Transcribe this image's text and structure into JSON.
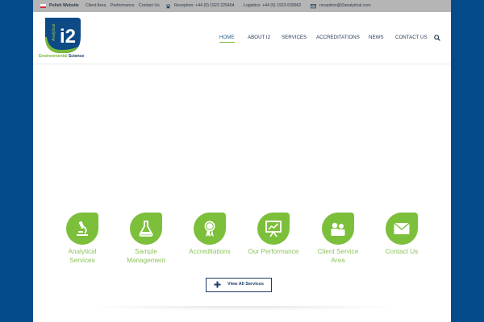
{
  "topbar": {
    "polish_website": "Polish Website",
    "links": [
      "Client Area",
      "Performance",
      "Contact Us"
    ],
    "reception": "Reception: +44 (0) 1923 225404",
    "logistics": "Logistics: +44 (0) 1923 639962",
    "email": "reception@i2analytical.com"
  },
  "logo": {
    "text_green": "Environmental",
    "text_blue": "Science",
    "mark": "i2",
    "mark_small": "Analytical"
  },
  "nav": {
    "items": [
      "HOME",
      "ABOUT I2",
      "SERVICES",
      "ACCREDITATIONS",
      "NEWS",
      "CONTACT US"
    ],
    "active": "HOME"
  },
  "services": [
    {
      "line1": "Analytical",
      "line2": "Services",
      "icon": "microscope-icon"
    },
    {
      "line1": "Sample",
      "line2": "Management",
      "icon": "flask-icon"
    },
    {
      "line1": "Accreditations",
      "line2": "",
      "icon": "award-icon"
    },
    {
      "line1": "Our Performance",
      "line2": "",
      "icon": "chart-board-icon"
    },
    {
      "line1": "Client Service",
      "line2": "Area",
      "icon": "users-icon"
    },
    {
      "line1": "Contact Us",
      "line2": "",
      "icon": "envelope-icon"
    }
  ],
  "view_all": "View All Services",
  "colors": {
    "brand_blue": "#034b8a",
    "accent_green": "#7cbf3a",
    "topbar_gray": "#b5b5b5",
    "nav_text": "#1e3550"
  }
}
